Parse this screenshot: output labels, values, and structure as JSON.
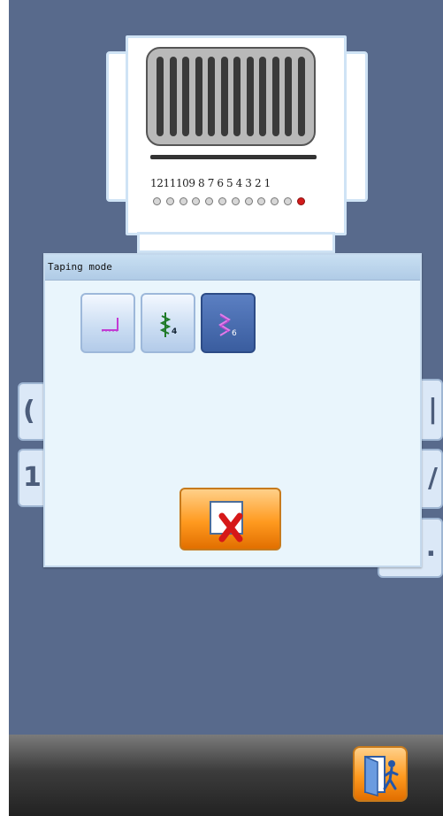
{
  "machine": {
    "needle_numbers": "1211109 8 7 6 5 4 3 2 1",
    "needle_count": 12,
    "active_needle": 1
  },
  "dialog": {
    "title": "Taping mode",
    "modes": [
      {
        "icon": "straight-stitch-icon",
        "selected": false
      },
      {
        "icon": "zigzag-4-icon",
        "label": "4",
        "selected": false
      },
      {
        "icon": "zigzag-6-icon",
        "label": "6",
        "selected": true
      }
    ],
    "cancel_icon": "close-x-icon"
  },
  "side_buttons": {
    "left_labels": [
      "(",
      "1"
    ],
    "right_labels": [
      "|",
      "/",
      "."
    ]
  },
  "bottom": {
    "exit_icon": "exit-door-icon"
  },
  "colors": {
    "background": "#586a8c",
    "dialog_bg": "#e9f5fc",
    "accent_orange": "#ff9a1f",
    "selected_blue": "#3a5d9f",
    "active_needle": "#d21b1b"
  }
}
